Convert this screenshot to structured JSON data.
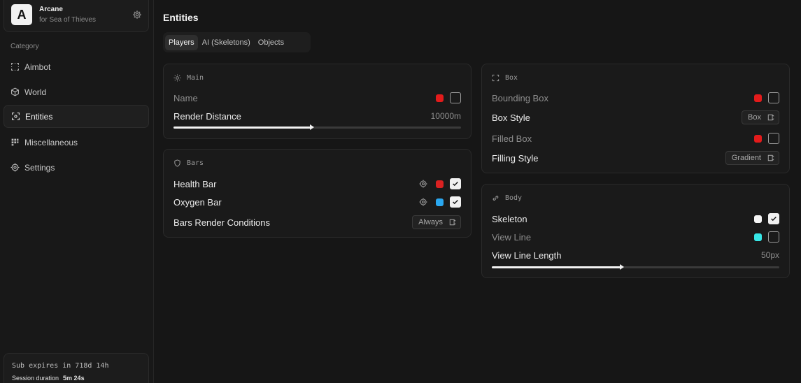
{
  "brand": {
    "logo_letter": "A",
    "name": "Arcane",
    "subtitle": "for Sea of Thieves",
    "settings_icon": "gear-icon"
  },
  "sidebar": {
    "category_label": "Category",
    "items": [
      {
        "label": "Aimbot",
        "icon": "crosshair-dashed-icon",
        "active": false
      },
      {
        "label": "World",
        "icon": "cube-icon",
        "active": false
      },
      {
        "label": "Entities",
        "icon": "scan-target-icon",
        "active": true
      },
      {
        "label": "Miscellaneous",
        "icon": "grid-dots-icon",
        "active": false
      },
      {
        "label": "Settings",
        "icon": "gear-icon",
        "active": false
      }
    ],
    "subscription": {
      "expires": "Sub expires in 718d 14h",
      "session_label": "Session duration",
      "session_value": "5m 24s"
    }
  },
  "page": {
    "title": "Entities"
  },
  "tabs": [
    {
      "label": "Players",
      "active": true
    },
    {
      "label": "AI (Skeletons)",
      "active": false
    },
    {
      "label": "Objects",
      "active": false
    }
  ],
  "main_card": {
    "title": "Main",
    "name_label": "Name",
    "name_color": "#e31b1b",
    "name_checked": false,
    "render_distance_label": "Render Distance",
    "render_distance_value": "10000m",
    "render_distance_fraction": 0.48
  },
  "bars_card": {
    "title": "Bars",
    "health_label": "Health Bar",
    "health_color": "#d92121",
    "health_checked": true,
    "oxygen_label": "Oxygen Bar",
    "oxygen_color": "#2aa7f0",
    "oxygen_checked": true,
    "conditions_label": "Bars Render Conditions",
    "conditions_value": "Always"
  },
  "box_card": {
    "title": "Box",
    "bounding_label": "Bounding Box",
    "bounding_color": "#e31b1b",
    "bounding_checked": false,
    "style_label": "Box Style",
    "style_value": "Box",
    "filled_label": "Filled Box",
    "filled_color": "#e31b1b",
    "filled_checked": false,
    "filling_label": "Filling Style",
    "filling_value": "Gradient"
  },
  "body_card": {
    "title": "Body",
    "skeleton_label": "Skeleton",
    "skeleton_color": "#f5f5f5",
    "skeleton_checked": true,
    "viewline_label": "View Line",
    "viewline_color": "#37e6e6",
    "viewline_checked": false,
    "viewline_length_label": "View Line Length",
    "viewline_length_value": "50px",
    "viewline_length_fraction": 0.45
  }
}
